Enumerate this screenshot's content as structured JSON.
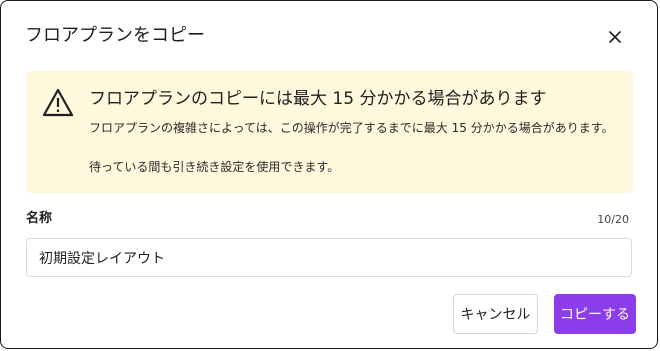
{
  "dialog": {
    "title": "フロアプランをコピー",
    "close_icon": "close-icon"
  },
  "warning": {
    "icon": "warning-triangle-icon",
    "heading": "フロアプランのコピーには最大 15 分かかる場合があります",
    "line1": "フロアプランの複雑さによっては、この操作が完了するまでに最大 15 分かかる場合があります。",
    "line2": "待っている間も引き続き設定を使用できます。"
  },
  "name_field": {
    "label": "名称",
    "count": "10/20",
    "value": "初期設定レイアウト"
  },
  "buttons": {
    "cancel": "キャンセル",
    "copy": "コピーする"
  },
  "colors": {
    "primary": "#8b3dea",
    "warning_bg": "#fff8dd"
  }
}
